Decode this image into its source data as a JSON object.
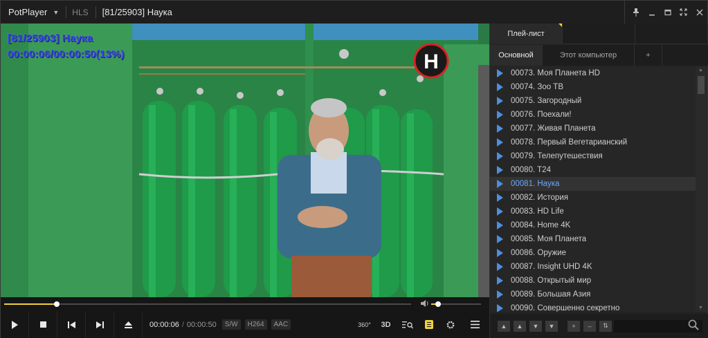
{
  "titlebar": {
    "app_name": "PotPlayer",
    "format": "HLS",
    "title": "[81/25903] Наука"
  },
  "video": {
    "osd_line1": "[81/25903] Наука",
    "osd_line2": "00:00:06/00:00:50(13%)",
    "channel_logo": "H"
  },
  "seek": {
    "progress_fraction": 0.13
  },
  "volume": {
    "level_fraction": 0.14
  },
  "controls": {
    "time_current": "00:00:06",
    "time_separator": "/",
    "time_total": "00:00:50",
    "tags": [
      "S/W",
      "H264",
      "AAC"
    ],
    "tools": {
      "vr_label": "360°",
      "threed_label": "3D"
    }
  },
  "playlist": {
    "top_tabs": [
      "Плей-лист",
      "",
      ""
    ],
    "sub_tabs": [
      "Основной",
      "Этот компьютер",
      "+"
    ],
    "active_index": 8,
    "items": [
      "00073. Моя Планета HD",
      "00074. Зоо ТВ",
      "00075. Загородный",
      "00076. Поехали!",
      "00077. Живая Планета",
      "00078. Первый Вегетарианский",
      "00079. Телепутешествия",
      "00080. T24",
      "00081. Наука",
      "00082. История",
      "00083. HD Life",
      "00084. Home 4K",
      "00085. Моя Планета",
      "00086. Оружие",
      "00087. Insight UHD 4K",
      "00088. Открытый мир",
      "00089. Большая Азия",
      "00090. Совершенно секретно"
    ]
  },
  "colors": {
    "accent": "#f0d23a",
    "playlist_active_text": "#6aa8ff",
    "play_icon": "#4d8fe0",
    "osd_text": "#2d3fd8"
  }
}
